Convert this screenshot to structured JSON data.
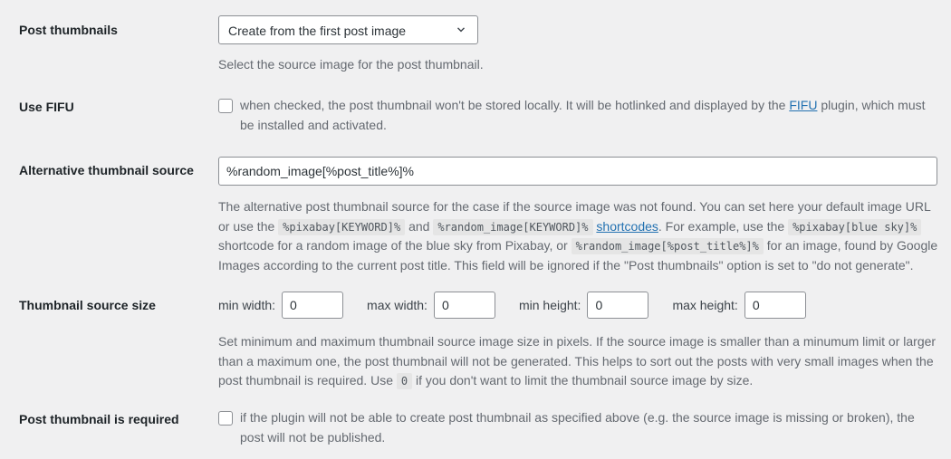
{
  "page": {
    "background_color": "#f0f0f1",
    "label_color": "#1d2327",
    "description_color": "#646970",
    "link_color": "#2271b1",
    "code_background": "#e5e5e5",
    "input_border_color": "#8c8f94"
  },
  "rows": {
    "post_thumbnails": {
      "label": "Post thumbnails",
      "select": {
        "selected": "Create from the first post image",
        "icon": "chevron-down-icon"
      },
      "description": "Select the source image for the post thumbnail."
    },
    "use_fifu": {
      "label": "Use FIFU",
      "checkbox_checked": false,
      "text_before_link": "when checked, the post thumbnail won't be stored locally. It will be hotlinked and displayed by the ",
      "link_text": "FIFU",
      "text_after_link": " plugin, which must be installed and activated."
    },
    "alternative_thumbnail_source": {
      "label": "Alternative thumbnail source",
      "input_value": "%random_image[%post_title%]%",
      "input_placeholder": "",
      "desc_part_1": "The alternative post thumbnail source for the case if the source image was not found. You can set here your default image URL or use the ",
      "code_1": "%pixabay[KEYWORD]%",
      "desc_part_2": " and ",
      "code_2": "%random_image[KEYWORD]%",
      "desc_part_3": " ",
      "link_text": "shortcodes",
      "desc_part_4": ". For example, use the ",
      "code_3": "%pixabay[blue sky]%",
      "desc_part_5": " shortcode for a random image of the blue sky from Pixabay, or ",
      "code_4": "%random_image[%post_title%]%",
      "desc_part_6": " for an image, found by Google Images according to the current post title. This field will be ignored if the \"Post thumbnails\" option is set to \"do not generate\"."
    },
    "thumbnail_source_size": {
      "label": "Thumbnail source size",
      "fields": [
        {
          "label": "min width:",
          "value": "0",
          "name": "min-width"
        },
        {
          "label": "max width:",
          "value": "0",
          "name": "max-width"
        },
        {
          "label": "min height:",
          "value": "0",
          "name": "min-height"
        },
        {
          "label": "max height:",
          "value": "0",
          "name": "max-height"
        }
      ],
      "desc_part_1": "Set minimum and maximum thumbnail source image size in pixels. If the source image is smaller than a minumum limit or larger than a maximum one, the post thumbnail will not be generated. This helps to sort out the posts with very small images when the post thumbnail is required. Use ",
      "code_1": "0",
      "desc_part_2": " if you don't want to limit the thumbnail source image by size."
    },
    "post_thumbnail_is_required": {
      "label": "Post thumbnail is required",
      "checkbox_checked": false,
      "text": "if the plugin will not be able to create post thumbnail as specified above (e.g. the source image is missing or broken), the post will not be published."
    }
  }
}
